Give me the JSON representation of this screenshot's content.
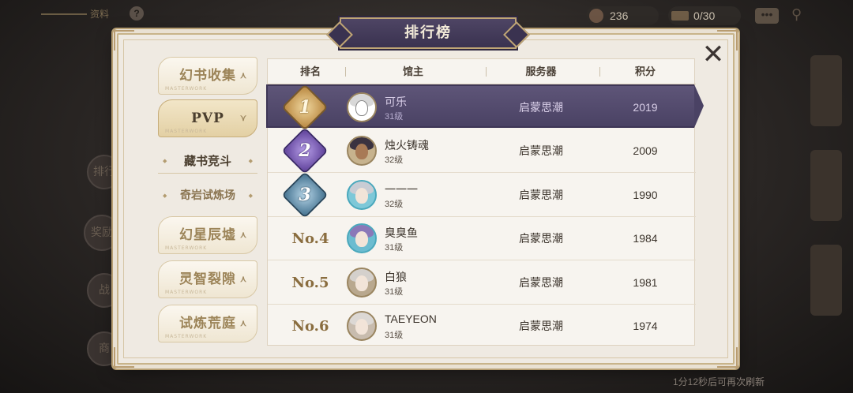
{
  "hud": {
    "logo_text": "资料",
    "help_label": "?",
    "gem_count": "236",
    "ticket_count": "0/30",
    "chat_label": "•••"
  },
  "background": {
    "side_buttons": [
      "排行",
      "奖励",
      "战",
      "商"
    ],
    "refresh_note": "1分12秒后可再次刷新"
  },
  "modal": {
    "title": "排行榜",
    "close_label": "✕"
  },
  "menu": {
    "items": [
      {
        "label": "幻书收集",
        "arrow": "⋏",
        "mark": "MASTERWORK"
      },
      {
        "label": "PVP",
        "arrow": "⋎",
        "mark": "MASTERWORK"
      },
      {
        "label": "幻星辰墟",
        "arrow": "⋏",
        "mark": "MASTERWORK"
      },
      {
        "label": "灵智裂隙",
        "arrow": "⋏",
        "mark": "MASTERWORK"
      },
      {
        "label": "试炼荒庭",
        "arrow": "⋏",
        "mark": "MASTERWORK"
      }
    ],
    "submenu": [
      {
        "label": "藏书竞斗"
      },
      {
        "label": "奇岩试炼场"
      }
    ]
  },
  "table": {
    "headers": {
      "rank": "排名",
      "player": "馆主",
      "server": "服务器",
      "score": "积分"
    },
    "rows": [
      {
        "rank": "1",
        "name": "可乐",
        "level": "31级",
        "server": "启蒙思潮",
        "score": "2019"
      },
      {
        "rank": "2",
        "name": "烛火铸魂",
        "level": "32级",
        "server": "启蒙思潮",
        "score": "2009"
      },
      {
        "rank": "3",
        "name": "一一一",
        "level": "32级",
        "server": "启蒙思潮",
        "score": "1990"
      },
      {
        "rank": "No.4",
        "name": "臭臭鱼",
        "level": "31级",
        "server": "启蒙思潮",
        "score": "1984"
      },
      {
        "rank": "No.5",
        "name": "白狼",
        "level": "31级",
        "server": "启蒙思潮",
        "score": "1981"
      },
      {
        "rank": "No.6",
        "name": "TAEYEON",
        "level": "31级",
        "server": "启蒙思潮",
        "score": "1974"
      }
    ]
  },
  "colors": {
    "modal_bg": "#efeae2",
    "title_banner": "#4e4564",
    "selected_row": "#5e5578",
    "gold_medal": "#b8863e",
    "silver_purple_medal": "#5c3e98",
    "bronze_blue_medal": "#41708e"
  }
}
